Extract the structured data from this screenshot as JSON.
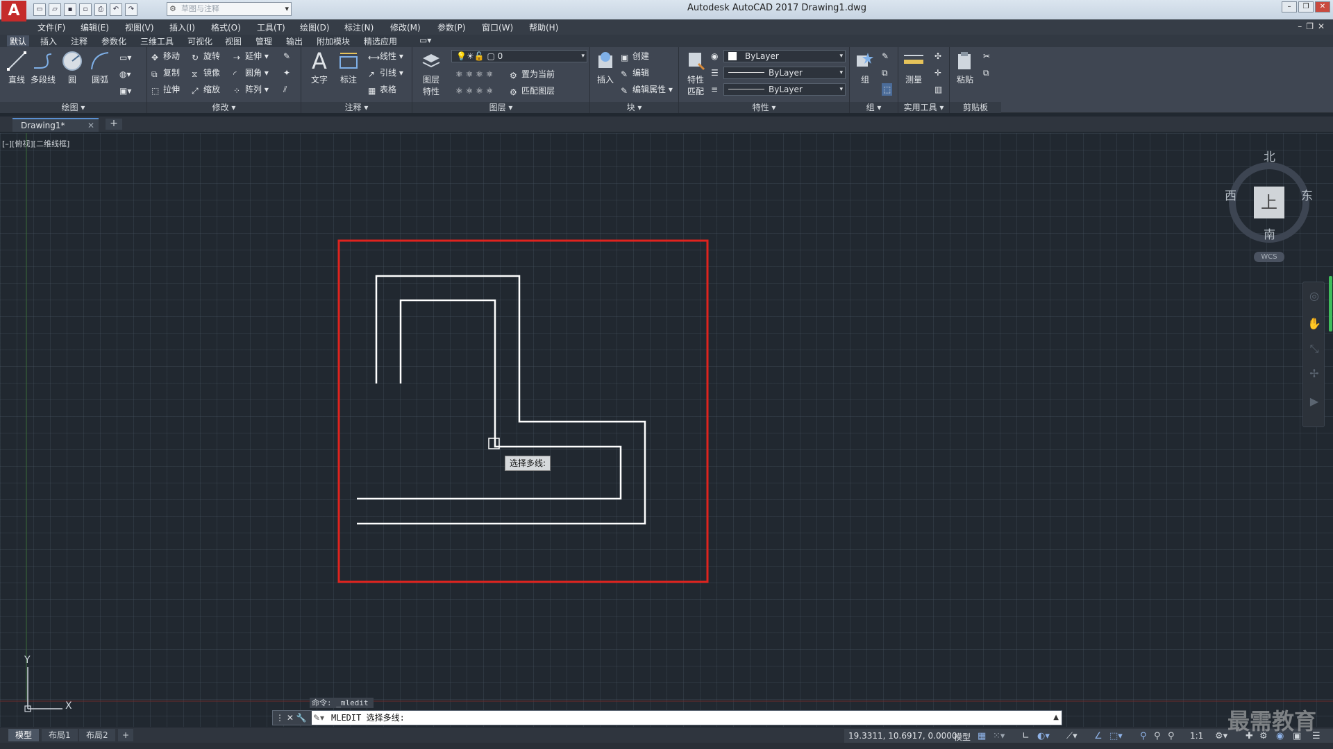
{
  "app": {
    "logo": "A",
    "title": "Autodesk AutoCAD 2017    Drawing1.dwg",
    "workspace_placeholder": "草图与注释"
  },
  "menubar": {
    "items": [
      "文件(F)",
      "编辑(E)",
      "视图(V)",
      "插入(I)",
      "格式(O)",
      "工具(T)",
      "绘图(D)",
      "标注(N)",
      "修改(M)",
      "参数(P)",
      "窗口(W)",
      "帮助(H)"
    ]
  },
  "ribbon_tabs": [
    "默认",
    "插入",
    "注释",
    "参数化",
    "三维工具",
    "可视化",
    "视图",
    "管理",
    "输出",
    "附加模块",
    "精选应用"
  ],
  "ribbon": {
    "draw": {
      "title": "绘图",
      "line": "直线",
      "polyline": "多段线",
      "circle": "圆",
      "arc": "圆弧"
    },
    "modify": {
      "title": "修改",
      "move": "移动",
      "rotate": "旋转",
      "extend": "延伸",
      "copy": "复制",
      "mirror": "镜像",
      "fillet": "圆角",
      "stretch": "拉伸",
      "scale": "缩放",
      "array": "阵列"
    },
    "annotation": {
      "title": "注释",
      "text": "文字",
      "dimension": "标注",
      "linear": "线性",
      "leader": "引线",
      "table": "表格"
    },
    "layers": {
      "title": "图层",
      "layer_properties": "图层\n特性",
      "layer_combo": "0",
      "set_current": "置为当前",
      "match_layer": "匹配图层"
    },
    "block": {
      "title": "块",
      "insert": "插入",
      "create": "创建",
      "edit": "编辑",
      "edit_attributes": "编辑属性"
    },
    "properties": {
      "title": "特性",
      "match": "特性\n匹配",
      "color": "ByLayer",
      "linetype": "ByLayer",
      "lineweight": "ByLayer"
    },
    "groups": {
      "title": "组",
      "group": "组"
    },
    "utilities": {
      "title": "实用工具",
      "measure": "测量"
    },
    "clipboard": {
      "title": "剪贴板",
      "paste": "粘贴"
    }
  },
  "file_tab": {
    "label": "Drawing1*"
  },
  "viewport": {
    "label": "[–][俯视][二维线框]"
  },
  "viewcube": {
    "north": "北",
    "south": "南",
    "east": "东",
    "west": "西",
    "face": "上",
    "wcs": "WCS"
  },
  "tooltip": "选择多线:",
  "command": {
    "history": "命令: _mledit",
    "prompt": "MLEDIT 选择多线:"
  },
  "ucs": {
    "x": "X",
    "y": "Y"
  },
  "layout_tabs": [
    "模型",
    "布局1",
    "布局2"
  ],
  "status": {
    "coords": "19.3311, 10.6917, 0.0000",
    "mode": "模型",
    "scale": "1:1"
  },
  "watermark": "最需教育",
  "colors": {
    "canvas": "#212830",
    "selection_box": "#e0231e",
    "multiline": "#ffffff"
  }
}
